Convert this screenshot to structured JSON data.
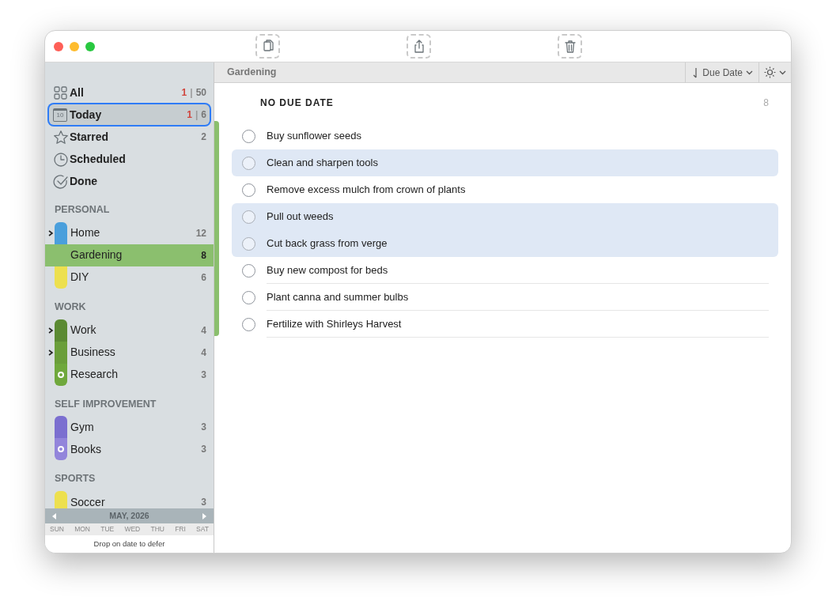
{
  "toolbar": {
    "buttons": [
      {
        "kind": "copy"
      },
      {
        "kind": "share"
      },
      {
        "kind": "trash"
      }
    ]
  },
  "smart_lists": [
    {
      "kind": "all",
      "label": "All",
      "overdue": "1",
      "separator": "|",
      "count": "50",
      "selected": false
    },
    {
      "kind": "today",
      "label": "Today",
      "icon_day": "10",
      "overdue": "1",
      "separator": "|",
      "count": "6",
      "selected": true
    },
    {
      "kind": "starred",
      "label": "Starred",
      "count": "2",
      "selected": false
    },
    {
      "kind": "scheduled",
      "label": "Scheduled",
      "selected": false
    },
    {
      "kind": "done",
      "label": "Done",
      "selected": false
    }
  ],
  "groups": [
    {
      "title": "PERSONAL",
      "lists": [
        {
          "label": "Home",
          "count": "12",
          "color": "#4a9fdc",
          "expandable": true,
          "marked": false,
          "selected": false
        },
        {
          "label": "Gardening",
          "count": "8",
          "color": "#8bbf6e",
          "expandable": false,
          "marked": false,
          "selected": true
        },
        {
          "label": "DIY",
          "count": "6",
          "color": "#ede04f",
          "expandable": false,
          "marked": false,
          "selected": false
        }
      ]
    },
    {
      "title": "WORK",
      "lists": [
        {
          "label": "Work",
          "count": "4",
          "color": "#5b8a33",
          "expandable": true,
          "marked": false,
          "selected": false
        },
        {
          "label": "Business",
          "count": "4",
          "color": "#6a9e3a",
          "expandable": true,
          "marked": false,
          "selected": false
        },
        {
          "label": "Research",
          "count": "3",
          "color": "#6fa83c",
          "expandable": false,
          "marked": true,
          "selected": false
        }
      ]
    },
    {
      "title": "SELF IMPROVEMENT",
      "lists": [
        {
          "label": "Gym",
          "count": "3",
          "color": "#7b6fd0",
          "expandable": false,
          "marked": false,
          "selected": false
        },
        {
          "label": "Books",
          "count": "3",
          "color": "#9285db",
          "expandable": false,
          "marked": true,
          "selected": false
        }
      ]
    },
    {
      "title": "SPORTS",
      "lists": [
        {
          "label": "Soccer",
          "count": "3",
          "color": "#ede04f",
          "expandable": false,
          "marked": false,
          "selected": false
        }
      ]
    }
  ],
  "calendar": {
    "month": "MAY, 2026",
    "days": [
      "SUN",
      "MON",
      "TUE",
      "WED",
      "THU",
      "FRI",
      "SAT"
    ],
    "hint": "Drop on date to defer"
  },
  "header": {
    "title": "Gardening",
    "sort": "Due Date"
  },
  "section": {
    "title": "NO DUE DATE",
    "count": "8"
  },
  "tasks": [
    {
      "title": "Buy sunflower seeds",
      "selected": false
    },
    {
      "title": "Clean and sharpen tools",
      "selected": true
    },
    {
      "title": "Remove excess mulch from crown of plants",
      "selected": false
    },
    {
      "title": "Pull out weeds",
      "selected": true
    },
    {
      "title": "Cut back grass from verge",
      "selected": true
    },
    {
      "title": "Buy new compost for beds",
      "selected": false
    },
    {
      "title": "Plant canna and summer bulbs",
      "selected": false
    },
    {
      "title": "Fertilize with Shirleys Harvest",
      "selected": false
    }
  ]
}
